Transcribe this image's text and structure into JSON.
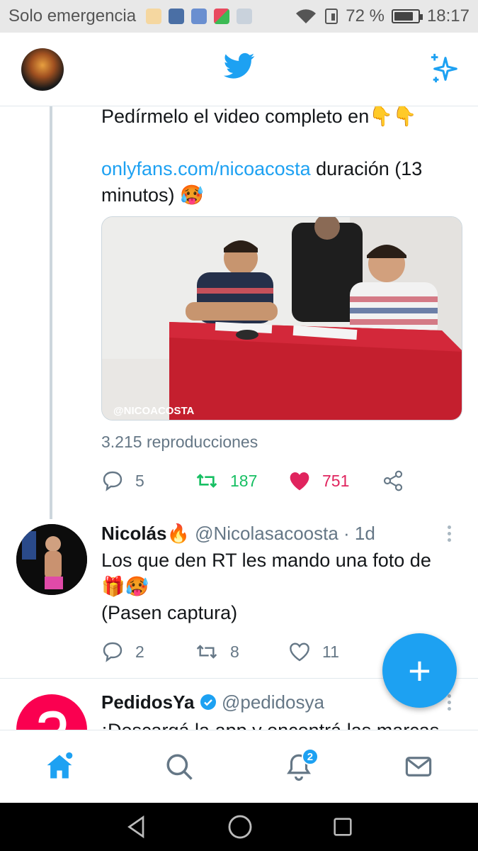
{
  "status_bar": {
    "carrier": "Solo emergencia",
    "battery_percent": "72 %",
    "battery_level": 0.72,
    "time": "18:17",
    "icons": [
      "hand-app-icon",
      "phone-app-icon",
      "health-app-icon",
      "play-games-icon",
      "mail-app-icon",
      "wifi-icon",
      "sim-icon",
      "battery-icon"
    ]
  },
  "header": {
    "logo_icon": "twitter-bird-icon",
    "sparkle_icon": "sparkle-icon",
    "avatar": "profile-avatar"
  },
  "tweet1": {
    "text_line1": "Pedírmelo el video completo en👇👇",
    "link": "onlyfans.com/nicoacosta",
    "text_after_link": " duración (13 minutos) 🥵",
    "media_watermark": "@NICOACOSTA",
    "views": "3.215 reproducciones",
    "replies": "5",
    "retweets": "187",
    "likes": "751",
    "retweeted": true,
    "liked": true
  },
  "tweet2": {
    "name": "Nicolás🔥",
    "handle": "@Nicolasacoosta",
    "time": " · 1d",
    "text_line1": "Los que den RT les mando una foto de",
    "text_line2": "🎁🥵",
    "text_line3": "(Pasen captura)",
    "replies": "2",
    "retweets": "8",
    "likes": "11"
  },
  "tweet3": {
    "name": "PedidosYa",
    "verified": true,
    "handle": "@pedidosya",
    "text_line1": "¡Descargá la app y encontrá las marcas"
  },
  "fab": {
    "label": "+"
  },
  "bottom_nav": {
    "items": [
      "home-icon",
      "search-icon",
      "notifications-icon",
      "messages-icon"
    ],
    "notifications_badge": "2"
  },
  "colors": {
    "accent": "#1da1f2",
    "retweet": "#17bf63",
    "like": "#e0245e",
    "muted": "#657786"
  }
}
